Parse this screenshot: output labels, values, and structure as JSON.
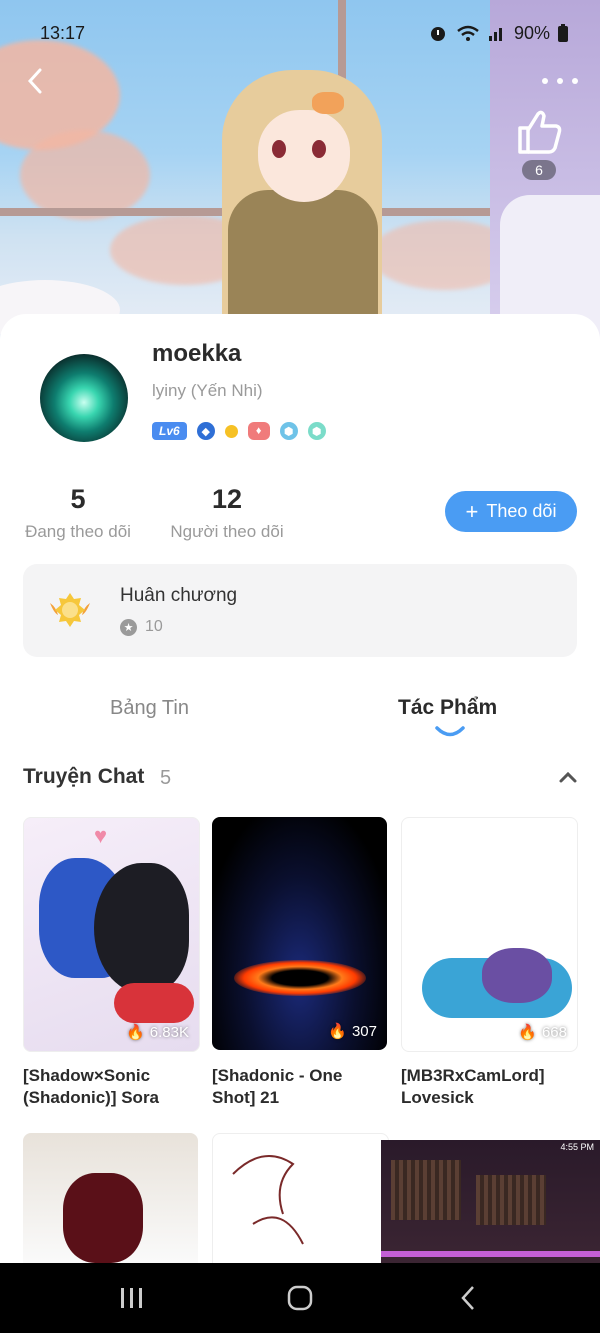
{
  "status_bar": {
    "time": "13:17",
    "battery": "90%"
  },
  "header": {
    "like_count": "6"
  },
  "profile": {
    "username": "moekka",
    "real_name": "lyiny (Yến Nhi)",
    "level_badge": "Lv6",
    "following_count": "5",
    "following_label": "Đang theo dõi",
    "followers_count": "12",
    "followers_label": "Người theo dõi",
    "follow_button": "Theo dõi"
  },
  "medals": {
    "title": "Huân chương",
    "count": "10"
  },
  "tabs": [
    {
      "label": "Bảng Tin",
      "active": false
    },
    {
      "label": "Tác Phẩm",
      "active": true
    }
  ],
  "section": {
    "title": "Truyện Chat",
    "count": "5"
  },
  "works": [
    {
      "title": "[Shadow×Sonic (Shadonic)] Sora",
      "views": "6.83K"
    },
    {
      "title": "[Shadonic - One Shot] 21",
      "views": "307"
    },
    {
      "title": "[MB3RxCamLord] Lovesick",
      "views": "668"
    }
  ],
  "row2_overlay": {
    "clock": "4:55 PM"
  },
  "colors": {
    "accent": "#4a9cf3",
    "level_badge": "#4a8cf0",
    "medal_bg": "#f4f4f5"
  },
  "icons": [
    "back-arrow-icon",
    "more-dots-icon",
    "thumbs-up-icon",
    "plus-icon",
    "medal-icon",
    "star-icon",
    "chevron-up-icon",
    "fire-icon",
    "recents-icon",
    "home-icon",
    "nav-back-icon"
  ]
}
